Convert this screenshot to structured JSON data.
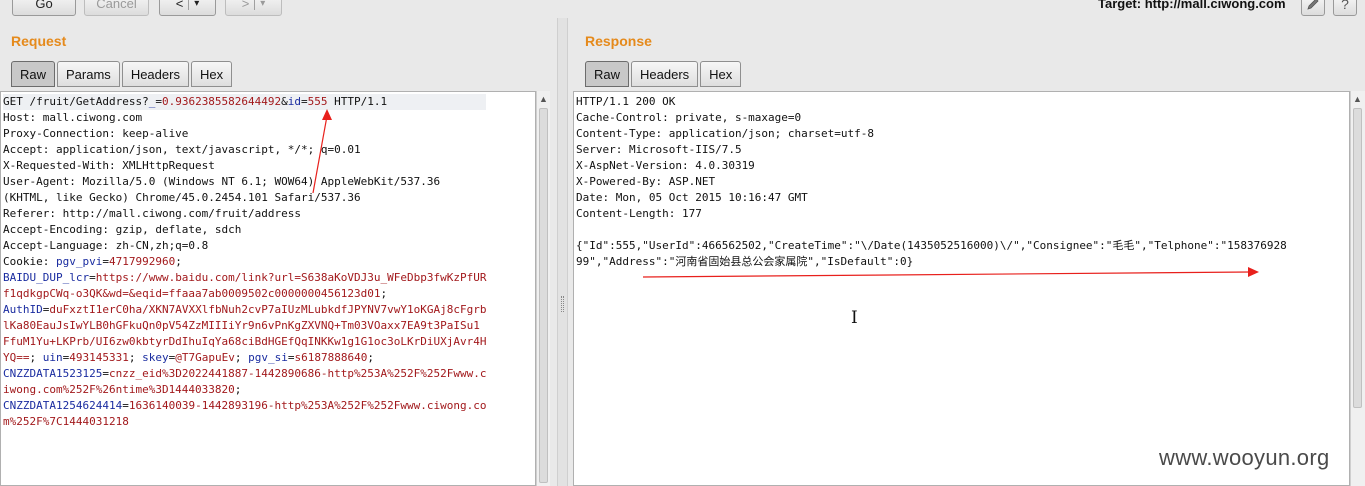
{
  "toolbar": {
    "go_label": "Go",
    "cancel_label": "Cancel",
    "back_label": "<",
    "back_menu_label": "▾",
    "forward_label": ">",
    "forward_menu_label": "▾",
    "target_text": "Target: http://mall.ciwong.com",
    "edit_icon": "pencil-icon",
    "help_label": "?"
  },
  "request": {
    "title": "Request",
    "tabs": [
      "Raw",
      "Params",
      "Headers",
      "Hex"
    ],
    "active_tab": "Raw",
    "lines": [
      [
        {
          "t": "GET /fruit/GetAddress?"
        },
        {
          "t": "_",
          "c": "k"
        },
        {
          "t": "="
        },
        {
          "t": "0.9362385582644492",
          "c": "v"
        },
        {
          "t": "&"
        },
        {
          "t": "id",
          "c": "k"
        },
        {
          "t": "="
        },
        {
          "t": "555",
          "c": "v"
        },
        {
          "t": " HTTP/1.1"
        }
      ],
      [
        {
          "t": "Host: mall.ciwong.com"
        }
      ],
      [
        {
          "t": "Proxy-Connection: keep-alive"
        }
      ],
      [
        {
          "t": "Accept: application/json, text/javascript, */*; q=0.01"
        }
      ],
      [
        {
          "t": "X-Requested-With: XMLHttpRequest"
        }
      ],
      [
        {
          "t": "User-Agent: Mozilla/5.0 (Windows NT 6.1; WOW64) AppleWebKit/537.36"
        }
      ],
      [
        {
          "t": "(KHTML, like Gecko) Chrome/45.0.2454.101 Safari/537.36"
        }
      ],
      [
        {
          "t": "Referer: http://mall.ciwong.com/fruit/address"
        }
      ],
      [
        {
          "t": "Accept-Encoding: gzip, deflate, sdch"
        }
      ],
      [
        {
          "t": "Accept-Language: zh-CN,zh;q=0.8"
        }
      ],
      [
        {
          "t": "Cookie: "
        },
        {
          "t": "pgv_pvi",
          "c": "k"
        },
        {
          "t": "="
        },
        {
          "t": "4717992960",
          "c": "v"
        },
        {
          "t": ";"
        }
      ],
      [
        {
          "t": "BAIDU_DUP_lcr",
          "c": "k"
        },
        {
          "t": "="
        },
        {
          "t": "https://www.baidu.com/link?url=S638aKoVDJ3u_WFeDbp3fwKzPfUR",
          "c": "v"
        }
      ],
      [
        {
          "t": "f1qdkgpCWq-o3QK&wd=&eqid=ffaaa7ab0009502c0000000456123d01",
          "c": "v"
        },
        {
          "t": ";"
        }
      ],
      [
        {
          "t": "AuthID",
          "c": "k"
        },
        {
          "t": "="
        },
        {
          "t": "duFxztI1erC0ha/XKN7AVXXlfbNuh2cvP7aIUzMLubkdfJPYNV7vwY1oKGAj8cFgrb",
          "c": "v"
        }
      ],
      [
        {
          "t": "lKa80EauJsIwYLB0hGFkuQn0pV54ZzMIIIiYr9n6vPnKgZXVNQ+Tm03VOaxx7EA9t3PaISu1",
          "c": "v"
        }
      ],
      [
        {
          "t": "FfuM1Yu+LKPrb/UI6zw0kbtyrDdIhuIqYa68ciBdHGEfQqINKKw1g1G1oc3oLKrDiUXjAvr4H",
          "c": "v"
        }
      ],
      [
        {
          "t": "YQ==",
          "c": "v"
        },
        {
          "t": "; "
        },
        {
          "t": "uin",
          "c": "k"
        },
        {
          "t": "="
        },
        {
          "t": "493145331",
          "c": "v"
        },
        {
          "t": "; "
        },
        {
          "t": "skey",
          "c": "k"
        },
        {
          "t": "="
        },
        {
          "t": "@T7GapuEv",
          "c": "v"
        },
        {
          "t": "; "
        },
        {
          "t": "pgv_si",
          "c": "k"
        },
        {
          "t": "="
        },
        {
          "t": "s6187888640",
          "c": "v"
        },
        {
          "t": ";"
        }
      ],
      [
        {
          "t": "CNZZDATA1523125",
          "c": "k"
        },
        {
          "t": "="
        },
        {
          "t": "cnzz_eid%3D2022441887-1442890686-http%253A%252F%252Fwww.c",
          "c": "v"
        }
      ],
      [
        {
          "t": "iwong.com%252F%26ntime%3D1444033820",
          "c": "v"
        },
        {
          "t": ";"
        }
      ],
      [
        {
          "t": "CNZZDATA1254624414",
          "c": "k"
        },
        {
          "t": "="
        },
        {
          "t": "1636140039-1442893196-http%253A%252F%252Fwww.ciwong.co",
          "c": "v"
        }
      ],
      [
        {
          "t": "m%252F%7C1444031218",
          "c": "v"
        }
      ]
    ]
  },
  "response": {
    "title": "Response",
    "tabs": [
      "Raw",
      "Headers",
      "Hex"
    ],
    "active_tab": "Raw",
    "lines": [
      [
        {
          "t": "HTTP/1.1 200 OK"
        }
      ],
      [
        {
          "t": "Cache-Control: private, s-maxage=0"
        }
      ],
      [
        {
          "t": "Content-Type: application/json; charset=utf-8"
        }
      ],
      [
        {
          "t": "Server: Microsoft-IIS/7.5"
        }
      ],
      [
        {
          "t": "X-AspNet-Version: 4.0.30319"
        }
      ],
      [
        {
          "t": "X-Powered-By: ASP.NET"
        }
      ],
      [
        {
          "t": "Date: Mon, 05 Oct 2015 10:16:47 GMT"
        }
      ],
      [
        {
          "t": "Content-Length: 177"
        }
      ],
      [
        {
          "t": ""
        }
      ],
      [
        {
          "t": "{\"Id\":555,\"UserId\":466562502,\"CreateTime\":\"\\/Date(1435052516000)\\/\",\"Consignee\":\"毛毛\",\"Telphone\":\"158376928"
        }
      ],
      [
        {
          "t": "99\",\"Address\":\"河南省固始县总公会家属院\",\"IsDefault\":0}"
        }
      ]
    ]
  },
  "watermark": "www.wooyun.org",
  "colors": {
    "title_orange": "#e58a1c",
    "annotation_red": "#e8201c",
    "param_name": "#1a2ca0",
    "param_value": "#a2191c"
  }
}
